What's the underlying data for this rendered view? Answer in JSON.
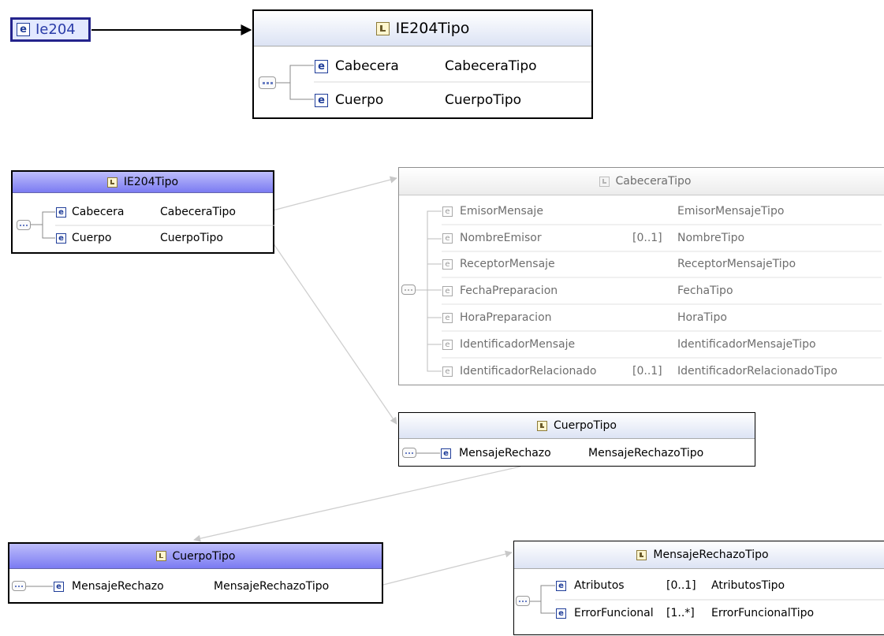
{
  "root": {
    "label": "Ie204"
  },
  "box1": {
    "title": "IE204Tipo",
    "rows": [
      {
        "name": "Cabecera",
        "type": "CabeceraTipo"
      },
      {
        "name": "Cuerpo",
        "type": "CuerpoTipo"
      }
    ]
  },
  "box2": {
    "title": "IE204Tipo",
    "rows": [
      {
        "name": "Cabecera",
        "type": "CabeceraTipo"
      },
      {
        "name": "Cuerpo",
        "type": "CuerpoTipo"
      }
    ]
  },
  "box3": {
    "title": "CabeceraTipo",
    "rows": [
      {
        "name": "EmisorMensaje",
        "card": "",
        "type": "EmisorMensajeTipo"
      },
      {
        "name": "NombreEmisor",
        "card": "[0..1]",
        "type": "NombreTipo"
      },
      {
        "name": "ReceptorMensaje",
        "card": "",
        "type": "ReceptorMensajeTipo"
      },
      {
        "name": "FechaPreparacion",
        "card": "",
        "type": "FechaTipo"
      },
      {
        "name": "HoraPreparacion",
        "card": "",
        "type": "HoraTipo"
      },
      {
        "name": "IdentificadorMensaje",
        "card": "",
        "type": "IdentificadorMensajeTipo"
      },
      {
        "name": "IdentificadorRelacionado",
        "card": "[0..1]",
        "type": "IdentificadorRelacionadoTipo"
      }
    ]
  },
  "box4": {
    "title": "CuerpoTipo",
    "rows": [
      {
        "name": "MensajeRechazo",
        "type": "MensajeRechazoTipo"
      }
    ]
  },
  "box5": {
    "title": "CuerpoTipo",
    "rows": [
      {
        "name": "MensajeRechazo",
        "type": "MensajeRechazoTipo"
      }
    ]
  },
  "box6": {
    "title": "MensajeRechazoTipo",
    "rows": [
      {
        "name": "Atributos",
        "card": "[0..1]",
        "type": "AtributosTipo"
      },
      {
        "name": "ErrorFuncional",
        "card": "[1..*]",
        "type": "ErrorFuncionalTipo"
      }
    ]
  },
  "icons": {
    "element": "e",
    "type_icon": "complex-type-icon",
    "sequence_icon": "sequence-compositor-icon"
  },
  "colors": {
    "selected_header": "#7b7bf2",
    "element_icon": "#1f3d99",
    "disabled_text": "#8a8a8a"
  }
}
